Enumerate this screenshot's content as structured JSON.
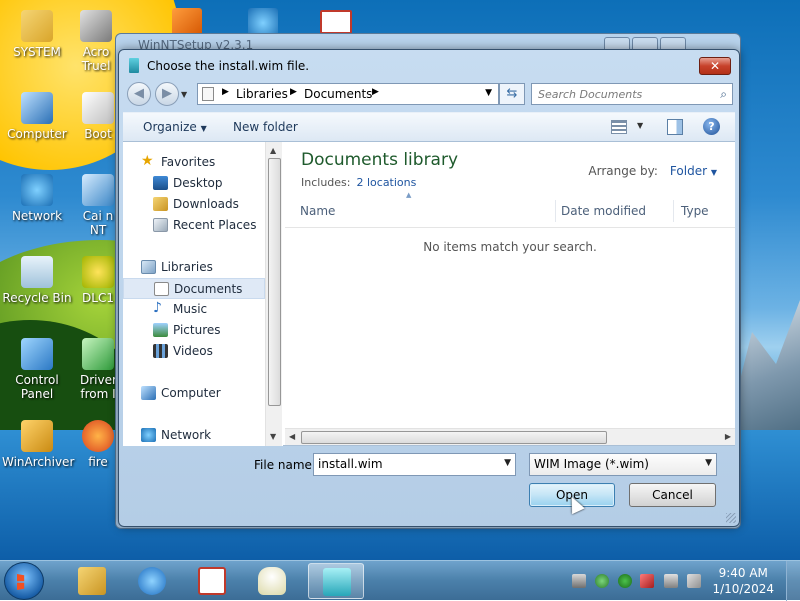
{
  "desktop": {
    "icons": [
      {
        "label": "SYSTEM",
        "icon": "folder-user-icon"
      },
      {
        "label": "Computer",
        "icon": "computer-icon"
      },
      {
        "label": "Network",
        "icon": "network-icon"
      },
      {
        "label": "Recycle Bin",
        "icon": "recycle-bin-icon"
      },
      {
        "label": "Control Panel",
        "icon": "control-panel-icon"
      },
      {
        "label": "WinArchiver",
        "icon": "archive-icon"
      },
      {
        "label": "Acro Truel",
        "icon": "acronis-icon"
      },
      {
        "label": "Boot",
        "icon": "boot-icon"
      },
      {
        "label": "Cai n NT",
        "icon": "setup-icon"
      },
      {
        "label": "DLC1",
        "icon": "dlc-icon"
      },
      {
        "label": "Driver from I",
        "icon": "driver-icon"
      },
      {
        "label": "fire",
        "icon": "firefox-icon"
      }
    ]
  },
  "background_window": {
    "title": "WinNTSetup v2.3.1"
  },
  "dialog": {
    "title": "Choose the install.wim file.",
    "close_label": "✕",
    "address": {
      "segments": [
        "Libraries",
        "Documents"
      ]
    },
    "search": {
      "placeholder": "Search Documents"
    },
    "toolbar": {
      "organize_label": "Organize",
      "new_folder_label": "New folder"
    },
    "nav": {
      "favorites_header": "Favorites",
      "favorites": [
        "Desktop",
        "Downloads",
        "Recent Places"
      ],
      "libraries_header": "Libraries",
      "libraries": [
        "Documents",
        "Music",
        "Pictures",
        "Videos"
      ],
      "selected": "Documents",
      "computer": "Computer",
      "network": "Network"
    },
    "library": {
      "title": "Documents library",
      "includes_label": "Includes:",
      "includes_link": "2 locations",
      "arrange_label": "Arrange by:",
      "arrange_value": "Folder"
    },
    "columns": [
      "Name",
      "Date modified",
      "Type"
    ],
    "empty_message": "No items match your search.",
    "filename": {
      "label": "File name:",
      "value": "install.wim"
    },
    "filetype": {
      "value": "WIM Image (*.wim)"
    },
    "buttons": {
      "open": "Open",
      "cancel": "Cancel"
    }
  },
  "taskbar": {
    "clock_time": "9:40 AM",
    "clock_date": "1/10/2024"
  },
  "colors": {
    "accent": "#1f55a0",
    "library_title": "#1e5a2c",
    "close_button": "#c7412b"
  }
}
